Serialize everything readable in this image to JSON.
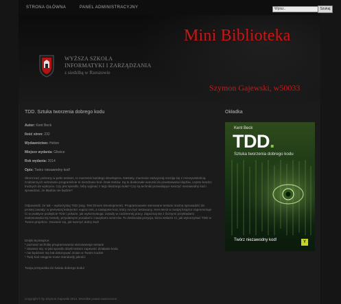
{
  "nav": {
    "home": "STRONA GŁÓWNA",
    "admin": "PANEL ADMINISTRACYJNY"
  },
  "search": {
    "value": "Wpisz..",
    "button": "Szukaj"
  },
  "header": {
    "title": "Mini Biblioteka",
    "author": "Szymon Gajewski, w50033",
    "university_line1": "WYŻSZA SZKOŁA",
    "university_line2": "INFORMATYKI I ZARZĄDZANIA",
    "university_line3": "z siedzibą w Rzeszowie"
  },
  "book": {
    "title": "TDD. Sztuka tworzenia dobrego kodu",
    "details": [
      {
        "label": "Autor:",
        "value": "Kent Beck"
      },
      {
        "label": "Ilość stron:",
        "value": "232"
      },
      {
        "label": "Wydawnictwo:",
        "value": "Helion"
      },
      {
        "label": "Miejsce wydania:",
        "value": "Gliwice"
      },
      {
        "label": "Rok wydania:",
        "value": "2014"
      },
      {
        "label": "Opis:",
        "value": "Twórz niezawodny kod!"
      }
    ],
    "paragraph1": "Skoro kod, pobrany w pełni testami, to marzenie każdego developera. Niestety, marzenie zazwyczaj rozmija się z rzeczywistością. Codziennych wdrażaniu programiście to niezdrowo kod i brak testów. Są to doskonałe warunki do powstawania błędów, często bardzo trudnych do wykrycia. Czy jest sposób, żeby wyjmać z tego błędnego koła? Czy są techniki pozwalające tworzyć niezawodny kod i sprawdzać, że błędów nie będzie?",
    "paragraph2": "Odpowiedź, że tak – wykorzystaj TDD (ang. Test Driven Development). Programowanie sterowane testami można sprowadzić do prostej zasady: w pierwszej kolejności napisz test, a następnie kod, który ma być testowany. Kent Beck w swojej książce zaprezentuje Ci w praktyce podejście TDD i pokaże, jak wykorzystując zasady w codziennej pracy. Zapoznaj się z licznymi przykładami zastosowania tej metody, przydatnymi poradami i nawykami wzorców. To doskonała pozycja, która wskaże Ci, jak wykorzystać TDD w Twoim projekcie. Dowiedz się, jak tworzyć dobry kod!",
    "bullets_intro": "Dzięki tej książce:",
    "bullets": [
      "* poznasz technikę programowania sterowanego testami",
      "* dowiesz się, w jaki sposób dzięki testom zapewnić działanie kodu",
      "* nie będziesz się bał dokonywać zmian w Twoim kodzie",
      "* Twój kod osiągnie nowe standardy jakości"
    ],
    "closing": "Twoja przepustka do świata dobrego kodu!"
  },
  "cover": {
    "heading": "Okładka",
    "author": "Kent Beck",
    "tdd": "TDD",
    "tdd_dot": ".",
    "subtitle": "Sztuka tworzenia dobrego kodu",
    "tagline": "Twórz niezawodny kod!",
    "publisher_mark": "Y",
    "accent_color": "#8bc34a"
  },
  "footer": {
    "text": "Copyright © by Szymon Gajewski 2014. Wszelkie prawa zastrzeżone."
  },
  "colors": {
    "title_red": "#c01a1a",
    "background": "#151515"
  }
}
